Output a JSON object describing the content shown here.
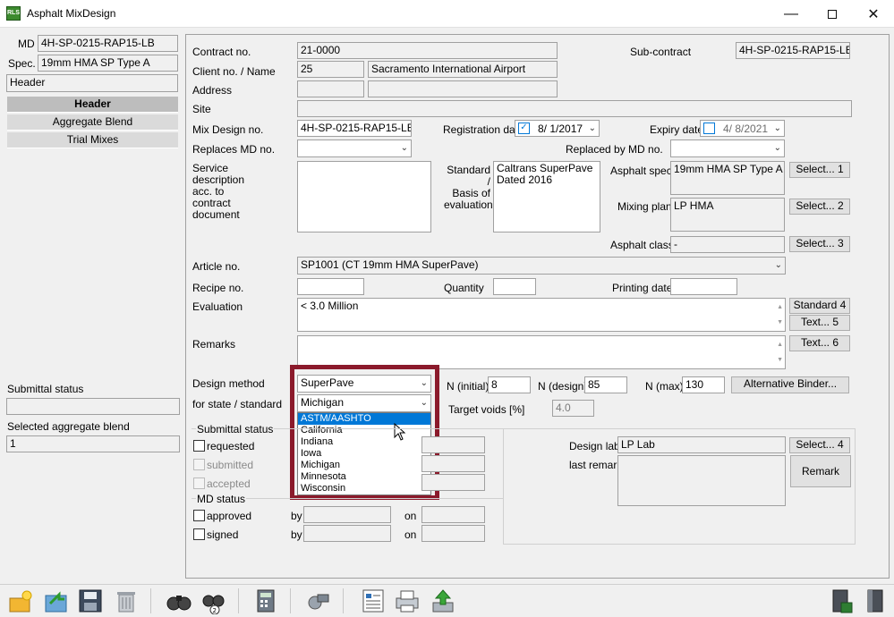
{
  "window": {
    "title": "Asphalt MixDesign",
    "icon_text": "RLS"
  },
  "sidebar": {
    "md_label": "MD",
    "md_value": "4H-SP-0215-RAP15-LB",
    "spec_label": "Spec.",
    "spec_value": "19mm HMA SP Type A",
    "section_value": "Header",
    "nav": [
      "Header",
      "Aggregate Blend",
      "Trial Mixes"
    ],
    "submittal_status_label": "Submittal status",
    "submittal_status_value": "",
    "selected_blend_label": "Selected aggregate blend",
    "selected_blend_value": "1"
  },
  "form": {
    "contract_label": "Contract no.",
    "contract_value": "21-0000",
    "subcontract_label": "Sub-contract",
    "subcontract_value": "4H-SP-0215-RAP15-LB",
    "client_label": "Client no. / Name",
    "client_no": "25",
    "client_name": "Sacramento International Airport",
    "address_label": "Address",
    "site_label": "Site",
    "mixdesign_label": "Mix Design no.",
    "mixdesign_value": "4H-SP-0215-RAP15-LB",
    "regdate_label": "Registration date",
    "regdate_value": "8/ 1/2017",
    "expiry_label": "Expiry date",
    "expiry_value": "4/ 8/2021",
    "replaces_label": "Replaces MD no.",
    "replacedby_label": "Replaced by MD no.",
    "service_label": "Service\ndescription\nacc. to\ncontract\ndocument",
    "standard_label": "Standard /\nBasis of\nevaluation",
    "standard_value": "Caltrans SuperPave\nDated 2016",
    "asphalt_spec_label": "Asphalt spec.",
    "asphalt_spec_value": "19mm HMA SP Type A",
    "mixing_plant_label": "Mixing plant",
    "mixing_plant_value": "LP HMA",
    "asphalt_class_label": "Asphalt class",
    "asphalt_class_value": "-",
    "select1": "Select... 1",
    "select2": "Select... 2",
    "select3": "Select... 3",
    "select4": "Select... 4",
    "article_label": "Article no.",
    "article_value": "SP1001 (CT 19mm HMA SuperPave)",
    "recipe_label": "Recipe no.",
    "quantity_label": "Quantity",
    "printing_label": "Printing date",
    "evaluation_label": "Evaluation",
    "evaluation_value": "< 3.0 Million",
    "standard4": "Standard 4",
    "text5": "Text... 5",
    "text6": "Text... 6",
    "remarks_label": "Remarks",
    "design_method_label": "Design method",
    "design_method_value": "SuperPave",
    "state_label": "for state / standard",
    "state_value": "Michigan",
    "n_initial_label": "N (initial)",
    "n_initial": "8",
    "n_design_label": "N (design)",
    "n_design": "85",
    "n_max_label": "N (max)",
    "n_max": "130",
    "alt_binder": "Alternative Binder...",
    "target_voids_label": "Target voids [%]",
    "target_voids": "4.0",
    "submittal_group": "Submittal status",
    "requested": "requested",
    "submitted": "submitted",
    "accepted": "accepted",
    "md_status_group": "MD status",
    "approved": "approved",
    "signed": "signed",
    "by": "by",
    "on": "on",
    "design_lab_label": "Design lab",
    "design_lab_value": "LP Lab",
    "last_remark_label": "last remark",
    "remark_btn": "Remark"
  },
  "state_dropdown": {
    "options": [
      "ASTM/AASHTO",
      "California",
      "Indiana",
      "Iowa",
      "Michigan",
      "Minnesota",
      "Wisconsin"
    ],
    "highlighted": "ASTM/AASHTO"
  },
  "colors": {
    "highlight_border": "#8b1a2b",
    "selection": "#0078d7"
  }
}
